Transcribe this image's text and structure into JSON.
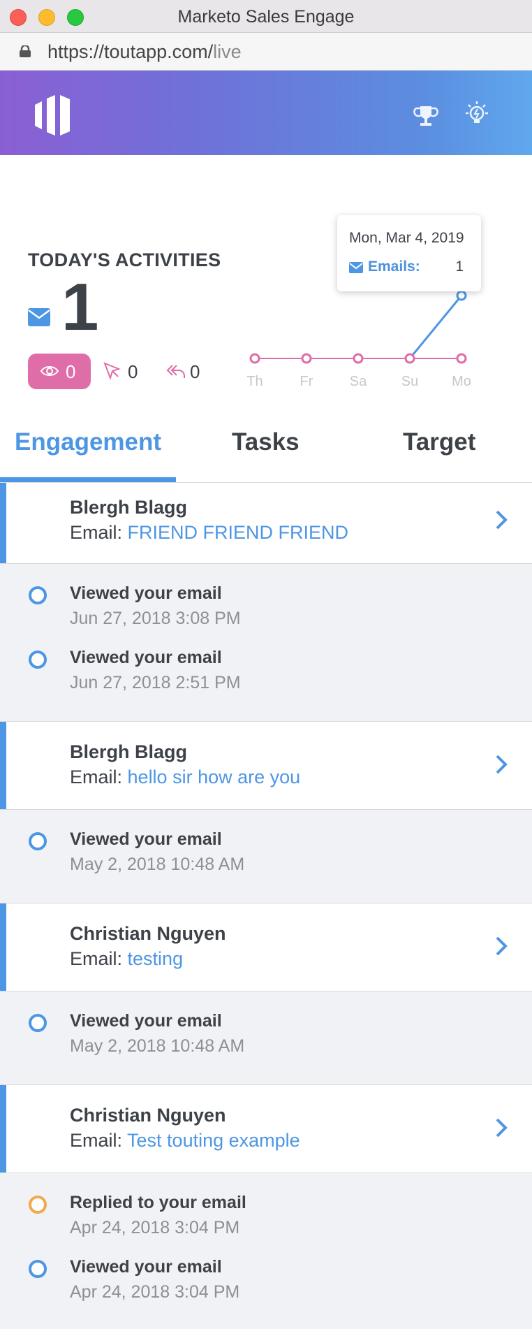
{
  "window": {
    "title": "Marketo Sales Engage"
  },
  "url": {
    "host": "https://toutapp.com/",
    "path": "live"
  },
  "colors": {
    "accent": "#4d96e3",
    "views_pill": "#df6da7",
    "reply_dot": "#f2a94f"
  },
  "header": {
    "icons": [
      "marketo-logo-icon",
      "trophy-icon",
      "lightbulb-icon"
    ]
  },
  "activities": {
    "title": "TODAY'S ACTIVITIES",
    "emails": "1",
    "views": "0",
    "clicks": "0",
    "replies": "0"
  },
  "chart_data": {
    "type": "line",
    "x": [
      "Th",
      "Fr",
      "Sa",
      "Su",
      "Mo"
    ],
    "series": [
      {
        "name": "Emails",
        "values": [
          0,
          0,
          0,
          0,
          1
        ],
        "color": "#4d96e3"
      },
      {
        "name": "",
        "values": [
          0,
          0,
          0,
          0,
          0
        ],
        "color": "#df6da7"
      }
    ],
    "ylim": [
      0,
      1
    ],
    "grid": false,
    "tooltip": {
      "date": "Mon, Mar 4, 2019",
      "label": "Emails:",
      "value": "1"
    }
  },
  "tabs": [
    {
      "label": "Engagement",
      "active": true
    },
    {
      "label": "Tasks",
      "active": false
    },
    {
      "label": "Target",
      "active": false
    }
  ],
  "feed": [
    {
      "name": "Blergh Blagg",
      "email_prefix": "Email: ",
      "subject": "FRIEND FRIEND FRIEND",
      "events": [
        {
          "type": "view",
          "title": "Viewed your email",
          "time": "Jun 27, 2018 3:08 PM"
        },
        {
          "type": "view",
          "title": "Viewed your email",
          "time": "Jun 27, 2018 2:51 PM"
        }
      ]
    },
    {
      "name": "Blergh Blagg",
      "email_prefix": "Email: ",
      "subject": "hello sir how are you",
      "events": [
        {
          "type": "view",
          "title": "Viewed your email",
          "time": "May 2, 2018 10:48 AM"
        }
      ]
    },
    {
      "name": "Christian Nguyen",
      "email_prefix": "Email: ",
      "subject": "testing",
      "events": [
        {
          "type": "view",
          "title": "Viewed your email",
          "time": "May 2, 2018 10:48 AM"
        }
      ]
    },
    {
      "name": "Christian Nguyen",
      "email_prefix": "Email: ",
      "subject": "Test touting example",
      "events": [
        {
          "type": "reply",
          "title": "Replied to your email",
          "time": "Apr 24, 2018 3:04 PM"
        },
        {
          "type": "view",
          "title": "Viewed your email",
          "time": "Apr 24, 2018 3:04 PM"
        }
      ]
    }
  ]
}
